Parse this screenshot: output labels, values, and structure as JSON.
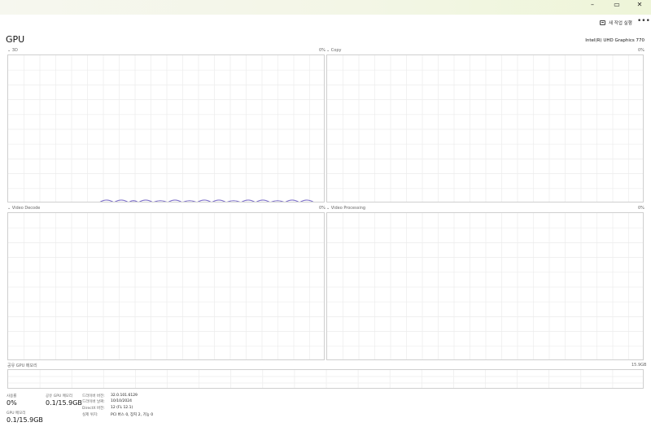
{
  "window": {
    "minimize_glyph": "–",
    "maximize_glyph": "▭",
    "close_glyph": "✕"
  },
  "toolbar": {
    "run_task_label": "새 작업 실행",
    "more_glyph": "•••"
  },
  "header": {
    "title": "GPU",
    "device_name": "Intel(R) UHD Graphics 770"
  },
  "engines": [
    {
      "label": "⌄ 3D",
      "percent": "0%"
    },
    {
      "label": "⌄ Copy",
      "percent": "0%"
    },
    {
      "label": "⌄ Video Decode",
      "percent": "0%"
    },
    {
      "label": "⌄ Video Processing",
      "percent": "0%"
    }
  ],
  "shared_memory": {
    "label": "공유 GPU 메모리",
    "max": "15.9GB"
  },
  "stats": {
    "utilization_label": "사용률",
    "utilization_value": "0%",
    "shared_mem_label": "공유 GPU 메모리",
    "shared_mem_value": "0.1/15.9GB",
    "gpu_mem_label": "GPU 메모리",
    "gpu_mem_value": "0.1/15.9GB"
  },
  "driver_info": [
    {
      "label": "드라이버 버전:",
      "value": "32.0.101.6129"
    },
    {
      "label": "드라이버 날짜:",
      "value": "10/10/2024"
    },
    {
      "label": "DirectX 버전:",
      "value": "12 (FL 12.1)"
    },
    {
      "label": "실제 위치:",
      "value": "PCI 버스 0, 장치 2, 기능 0"
    }
  ],
  "colors": {
    "graph_border": "#cfcfcf",
    "grid": "#ececec",
    "usage_line": "#7a6cc8"
  }
}
